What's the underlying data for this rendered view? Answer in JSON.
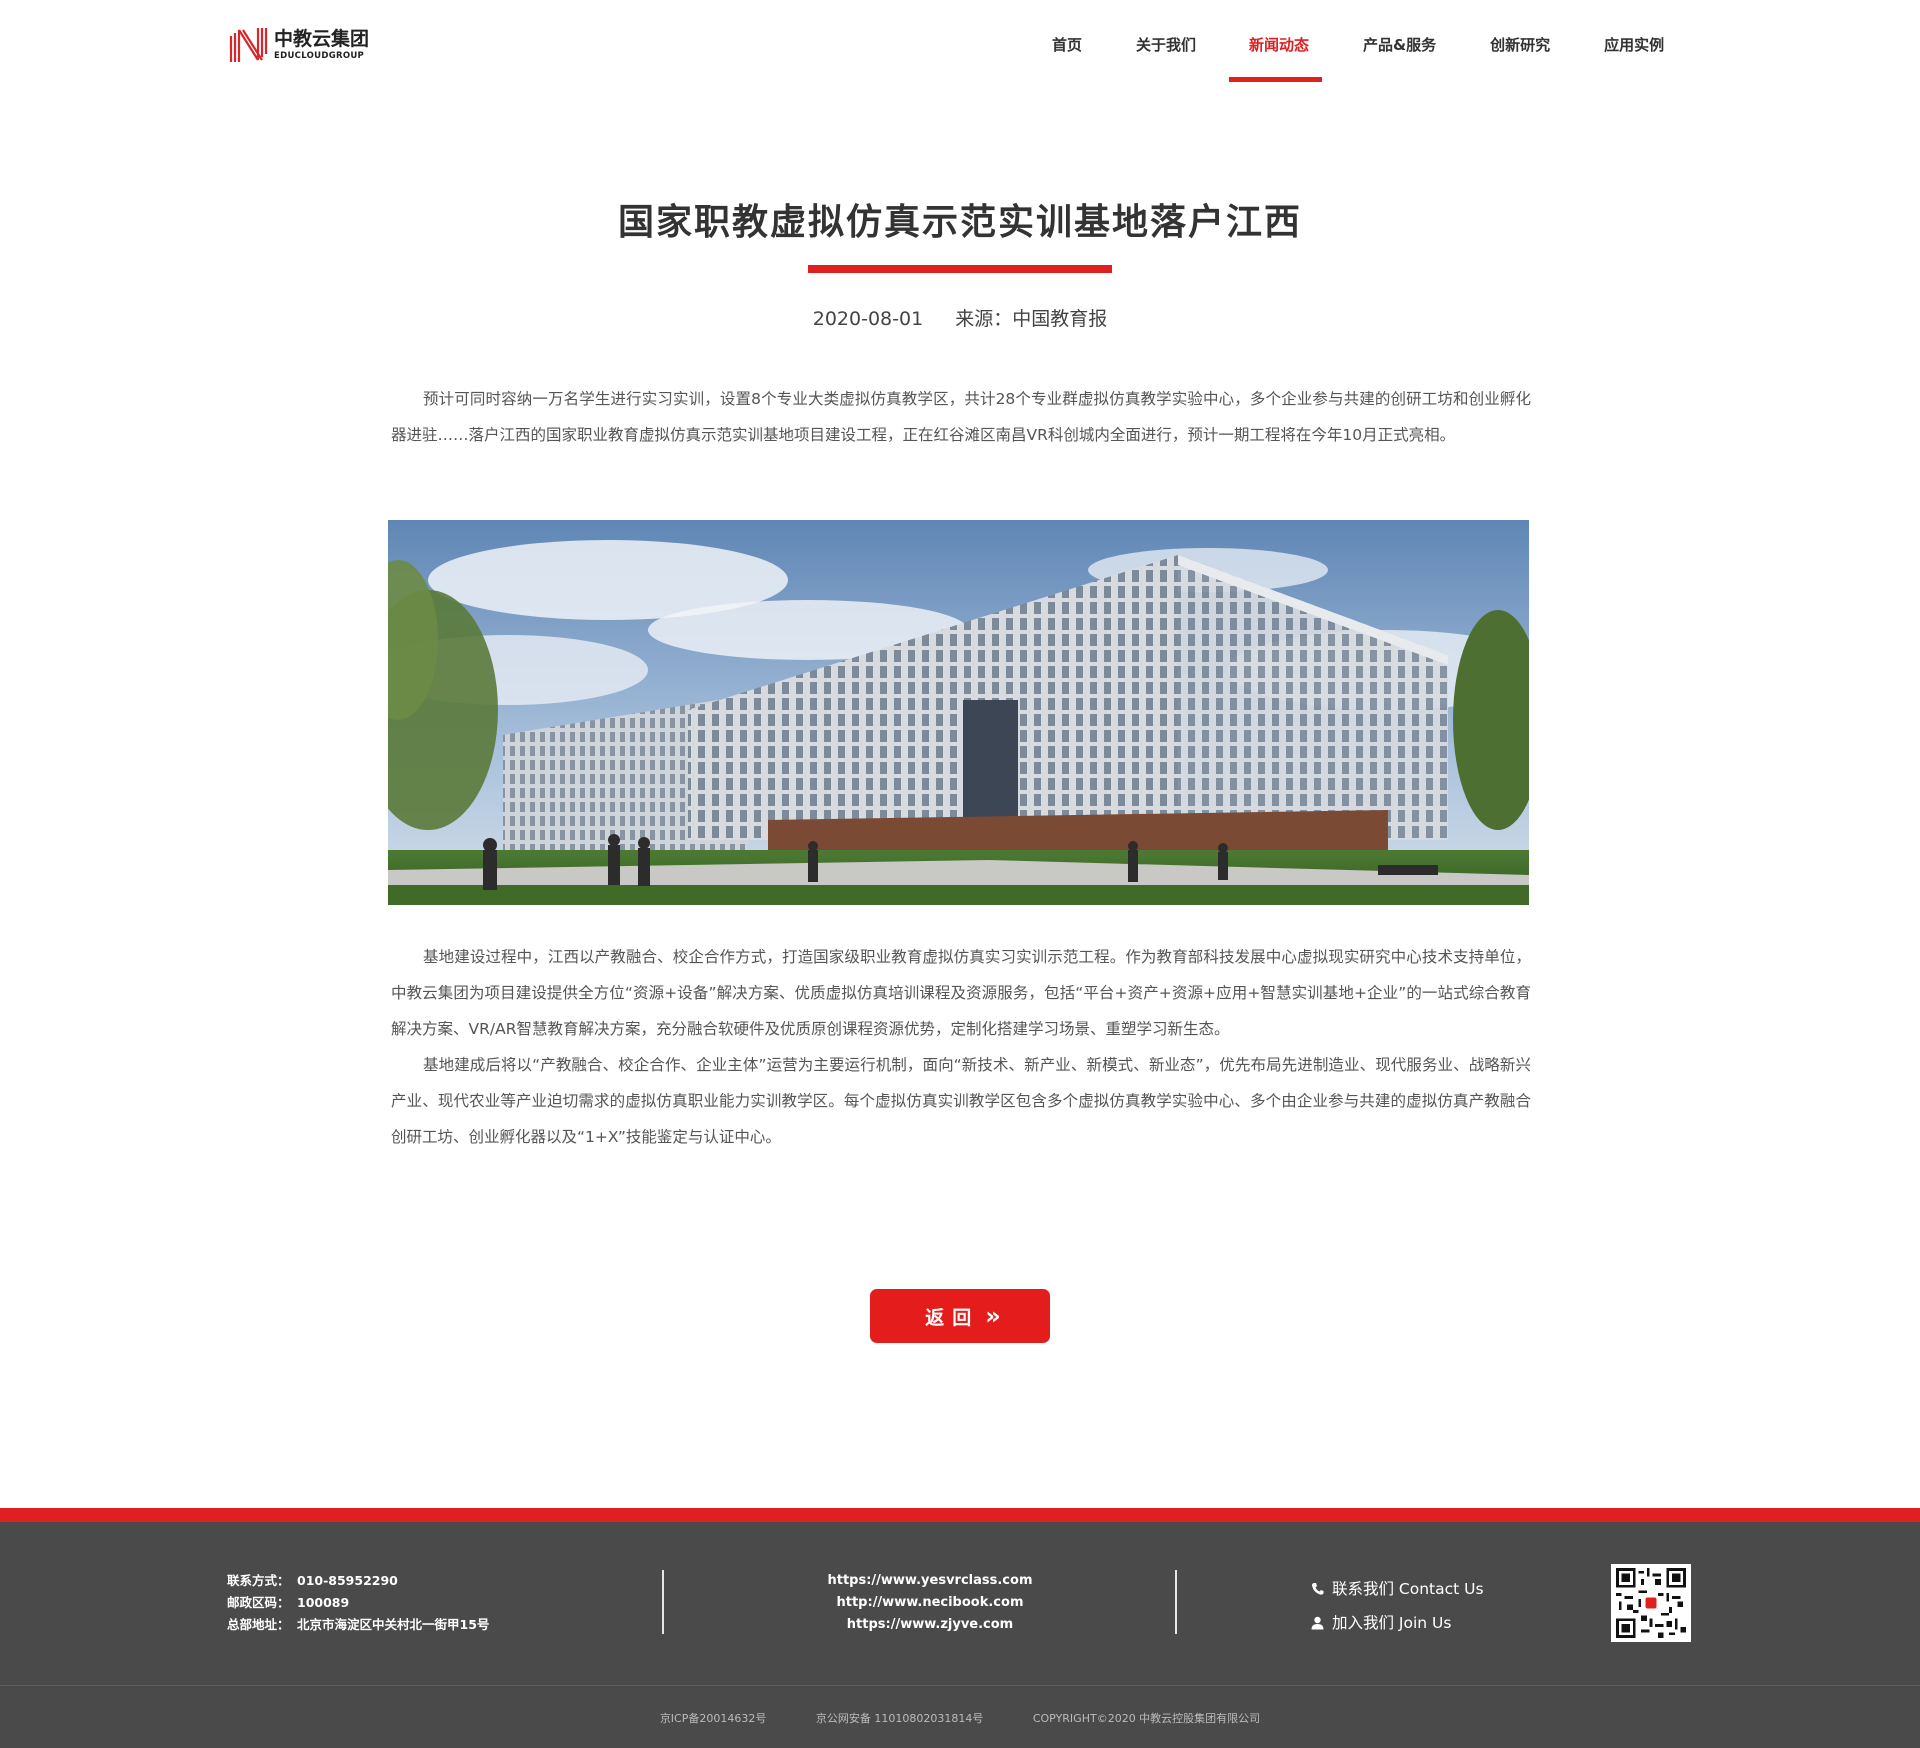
{
  "brand": {
    "name_cn": "中教云集团",
    "name_en": "EDUCLOUDGROUP",
    "accent": "#e02020"
  },
  "nav": {
    "items": [
      {
        "label": "首页",
        "active": false
      },
      {
        "label": "关于我们",
        "active": false
      },
      {
        "label": "新闻动态",
        "active": true
      },
      {
        "label": "产品&服务",
        "active": false
      },
      {
        "label": "创新研究",
        "active": false
      },
      {
        "label": "应用实例",
        "active": false
      }
    ]
  },
  "article": {
    "title": "国家职教虚拟仿真示范实训基地落户江西",
    "date": "2020-08-01",
    "source": "来源：中国教育报",
    "intro": "预计可同时容纳一万名学生进行实习实训，设置8个专业大类虚拟仿真教学区，共计28个专业群虚拟仿真教学实验中心，多个企业参与共建的创研工坊和创业孵化器进驻……落户江西的国家职业教育虚拟仿真示范实训基地项目建设工程，正在红谷滩区南昌VR科创城内全面进行，预计一期工程将在今年10月正式亮相。",
    "body1": "基地建设过程中，江西以产教融合、校企合作方式，打造国家级职业教育虚拟仿真实习实训示范工程。作为教育部科技发展中心虚拟现实研究中心技术支持单位，中教云集团为项目建设提供全方位“资源+设备”解决方案、优质虚拟仿真培训课程及资源服务，包括“平台+资产+资源+应用+智慧实训基地+企业”的一站式综合教育解决方案、VR/AR智慧教育解决方案，充分融合软硬件及优质原创课程资源优势，定制化搭建学习场景、重塑学习新生态。",
    "body2": "基地建成后将以“产教融合、校企合作、企业主体”运营为主要运行机制，面向“新技术、新产业、新模式、新业态”，优先布局先进制造业、现代服务业、战略新兴产业、现代农业等产业迫切需求的虚拟仿真职业能力实训教学区。每个虚拟仿真实训教学区包含多个虚拟仿真教学实验中心、多个由企业参与共建的虚拟仿真产教融合创研工坊、创业孵化器以及“1+X”技能鉴定与认证中心。"
  },
  "back_button": {
    "label": "返回",
    "arrow": "»"
  },
  "footer": {
    "contact": [
      {
        "label": "联系方式：",
        "value": "010-85952290"
      },
      {
        "label": "邮政区码：",
        "value": "100089"
      },
      {
        "label": "总部地址：",
        "value": "北京市海淀区中关村北一街甲15号"
      }
    ],
    "links": [
      "https://www.yesvrclass.com",
      "http://www.necibook.com",
      "https://www.zjyve.com"
    ],
    "contact_us": "联系我们 Contact Us",
    "join_us": "加入我们 Join Us",
    "icp": "京ICP备20014632号",
    "police": "京公网安备 11010802031814号",
    "copyright": "COPYRIGHT©2020 中教云控股集团有限公司"
  }
}
